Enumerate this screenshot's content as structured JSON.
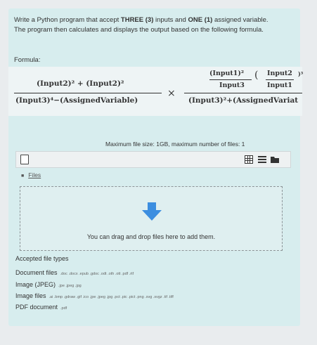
{
  "question": {
    "part1": "Write a Python program that accept ",
    "bold1": "THREE (3)",
    "part2": " inputs and ",
    "bold2": "ONE (1)",
    "part3": " assigned variable. The program then calculates and displays the output based on the following formula."
  },
  "formula": {
    "label": "Formula:",
    "frac1_num": "(Input2)² + (Input2)²",
    "frac1_den": "(Input3)⁴−(AssignedVariable)",
    "times": "×",
    "frac2_num1_top": "(Input1)²",
    "frac2_num1_bot": "Input3",
    "frac2_paren": "(",
    "frac2_num2_top": "Input2",
    "frac2_num2_bot": "Input1",
    "frac2_exp": ")³",
    "frac2_den": "(Input3)²+(AssignedVariat"
  },
  "filepicker": {
    "max_size": "Maximum file size: 1GB, maximum number of files: 1",
    "files_label": "Files",
    "drop_text": "You can drag and drop files here to add them."
  },
  "accepted": {
    "title": "Accepted file types",
    "types": [
      {
        "name": "Document files",
        "ext": ".doc .docx .epub .gdoc .odt .oth .ott .pdf .rtf"
      },
      {
        "name": "Image (JPEG)",
        "ext": ".jpe .jpeg .jpg"
      },
      {
        "name": "Image files",
        "ext": ".ai .bmp .gdraw .gif .ico .jpe .jpeg .jpg .pct .pic .pict .png .svg .svgz .tif .tiff"
      },
      {
        "name": "PDF document",
        "ext": ".pdf"
      }
    ]
  },
  "colors": {
    "card": "#d7edee",
    "arrow": "#3c8ee0"
  },
  "icons": [
    "add-file-icon",
    "grid-view-icon",
    "list-view-icon",
    "folder-view-icon",
    "folder-icon",
    "download-arrow-icon"
  ]
}
